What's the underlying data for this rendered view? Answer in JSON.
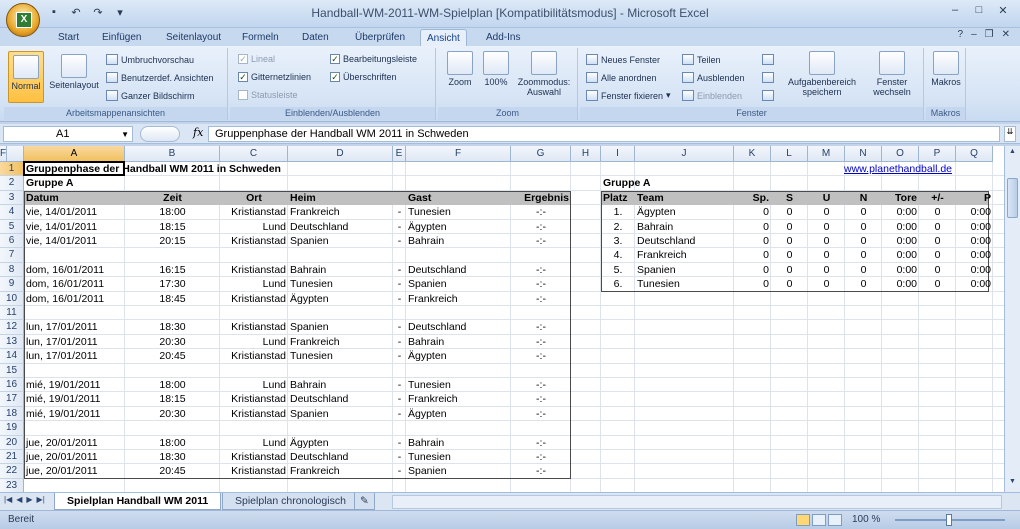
{
  "window": {
    "title": "Handball-WM-2011-WM-Spielplan  [Kompatibilitätsmodus] - Microsoft Excel"
  },
  "tabs": [
    "Start",
    "Einfügen",
    "Seitenlayout",
    "Formeln",
    "Daten",
    "Überprüfen",
    "Ansicht",
    "Add-Ins"
  ],
  "active_tab": "Ansicht",
  "ribbon": {
    "arbeitsmappen": {
      "label": "Arbeitsmappenansichten",
      "normal": "Normal",
      "seitenlayout": "Seitenlayout",
      "umbruch": "Umbruchvorschau",
      "benutzer": "Benutzerdef. Ansichten",
      "ganzer": "Ganzer Bildschirm"
    },
    "einblenden": {
      "label": "Einblenden/Ausblenden",
      "lineal": "Lineal",
      "gitternetz": "Gitternetzlinien",
      "statusleiste": "Statusleiste",
      "bearbeitung": "Bearbeitungsleiste",
      "ueberschriften": "Überschriften"
    },
    "zoom": {
      "label": "Zoom",
      "zoom": "Zoom",
      "hundert": "100%",
      "auswahl": "Zoommodus: Auswahl"
    },
    "fenster": {
      "label": "Fenster",
      "neues": "Neues Fenster",
      "alle": "Alle anordnen",
      "fixieren": "Fenster fixieren",
      "teilen": "Teilen",
      "ausblenden": "Ausblenden",
      "einblenden": "Einblenden",
      "aufgaben": "Aufgabenbereich speichern",
      "wechseln": "Fenster wechseln"
    },
    "makros": {
      "label": "Makros",
      "makros": "Makros"
    }
  },
  "formula_bar": {
    "name_box": "A1",
    "fx": "fx",
    "formula": "Gruppenphase der Handball WM 2011 in Schweden"
  },
  "columns": [
    "A",
    "B",
    "C",
    "D",
    "E",
    "F",
    "G",
    "H",
    "I",
    "J",
    "K",
    "L",
    "M",
    "N",
    "O",
    "P",
    "Q",
    "F"
  ],
  "rows": [
    "1",
    "2",
    "3",
    "4",
    "5",
    "6",
    "7",
    "8",
    "9",
    "10",
    "11",
    "12",
    "13",
    "14",
    "15",
    "16",
    "17",
    "18",
    "19",
    "20",
    "21",
    "22",
    "23"
  ],
  "sheet": {
    "title": "Gruppenphase der Handball WM 2011 in Schweden",
    "link": "www.planethandball.de",
    "group_label": "Gruppe A",
    "group_label_right": "Gruppe A",
    "headers": {
      "datum": "Datum",
      "zeit": "Zeit",
      "ort": "Ort",
      "heim": "Heim",
      "gast": "Gast",
      "ergebnis": "Ergebnis"
    },
    "matches": [
      {
        "row": 4,
        "datum": "vie, 14/01/2011",
        "zeit": "18:00",
        "ort": "Kristianstad",
        "heim": "Frankreich",
        "gast": "Tunesien",
        "erg": "-:-"
      },
      {
        "row": 5,
        "datum": "vie, 14/01/2011",
        "zeit": "18:15",
        "ort": "Lund",
        "heim": "Deutschland",
        "gast": "Ägypten",
        "erg": "-:-"
      },
      {
        "row": 6,
        "datum": "vie, 14/01/2011",
        "zeit": "20:15",
        "ort": "Kristianstad",
        "heim": "Spanien",
        "gast": "Bahrain",
        "erg": "-:-"
      },
      {
        "row": 8,
        "datum": "dom, 16/01/2011",
        "zeit": "16:15",
        "ort": "Kristianstad",
        "heim": "Bahrain",
        "gast": "Deutschland",
        "erg": "-:-"
      },
      {
        "row": 9,
        "datum": "dom, 16/01/2011",
        "zeit": "17:30",
        "ort": "Lund",
        "heim": "Tunesien",
        "gast": "Spanien",
        "erg": "-:-"
      },
      {
        "row": 10,
        "datum": "dom, 16/01/2011",
        "zeit": "18:45",
        "ort": "Kristianstad",
        "heim": "Ägypten",
        "gast": "Frankreich",
        "erg": "-:-"
      },
      {
        "row": 12,
        "datum": "lun, 17/01/2011",
        "zeit": "18:30",
        "ort": "Kristianstad",
        "heim": "Spanien",
        "gast": "Deutschland",
        "erg": "-:-"
      },
      {
        "row": 13,
        "datum": "lun, 17/01/2011",
        "zeit": "20:30",
        "ort": "Lund",
        "heim": "Frankreich",
        "gast": "Bahrain",
        "erg": "-:-"
      },
      {
        "row": 14,
        "datum": "lun, 17/01/2011",
        "zeit": "20:45",
        "ort": "Kristianstad",
        "heim": "Tunesien",
        "gast": "Ägypten",
        "erg": "-:-"
      },
      {
        "row": 16,
        "datum": "mié, 19/01/2011",
        "zeit": "18:00",
        "ort": "Lund",
        "heim": "Bahrain",
        "gast": "Tunesien",
        "erg": "-:-"
      },
      {
        "row": 17,
        "datum": "mié, 19/01/2011",
        "zeit": "18:15",
        "ort": "Kristianstad",
        "heim": "Deutschland",
        "gast": "Frankreich",
        "erg": "-:-"
      },
      {
        "row": 18,
        "datum": "mié, 19/01/2011",
        "zeit": "20:30",
        "ort": "Kristianstad",
        "heim": "Spanien",
        "gast": "Ägypten",
        "erg": "-:-"
      },
      {
        "row": 20,
        "datum": "jue, 20/01/2011",
        "zeit": "18:00",
        "ort": "Lund",
        "heim": "Ägypten",
        "gast": "Bahrain",
        "erg": "-:-"
      },
      {
        "row": 21,
        "datum": "jue, 20/01/2011",
        "zeit": "18:30",
        "ort": "Kristianstad",
        "heim": "Deutschland",
        "gast": "Tunesien",
        "erg": "-:-"
      },
      {
        "row": 22,
        "datum": "jue, 20/01/2011",
        "zeit": "20:45",
        "ort": "Kristianstad",
        "heim": "Frankreich",
        "gast": "Spanien",
        "erg": "-:-"
      }
    ],
    "dash": "-",
    "table_headers": [
      "Platz",
      "Team",
      "Sp.",
      "S",
      "U",
      "N",
      "Tore",
      "+/-",
      "P"
    ],
    "standings": [
      {
        "platz": "1.",
        "team": "Ägypten",
        "sp": "0",
        "s": "0",
        "u": "0",
        "n": "0",
        "tore": "0:00",
        "diff": "0",
        "p": "0:00"
      },
      {
        "platz": "2.",
        "team": "Bahrain",
        "sp": "0",
        "s": "0",
        "u": "0",
        "n": "0",
        "tore": "0:00",
        "diff": "0",
        "p": "0:00"
      },
      {
        "platz": "3.",
        "team": "Deutschland",
        "sp": "0",
        "s": "0",
        "u": "0",
        "n": "0",
        "tore": "0:00",
        "diff": "0",
        "p": "0:00"
      },
      {
        "platz": "4.",
        "team": "Frankreich",
        "sp": "0",
        "s": "0",
        "u": "0",
        "n": "0",
        "tore": "0:00",
        "diff": "0",
        "p": "0:00"
      },
      {
        "platz": "5.",
        "team": "Spanien",
        "sp": "0",
        "s": "0",
        "u": "0",
        "n": "0",
        "tore": "0:00",
        "diff": "0",
        "p": "0:00"
      },
      {
        "platz": "6.",
        "team": "Tunesien",
        "sp": "0",
        "s": "0",
        "u": "0",
        "n": "0",
        "tore": "0:00",
        "diff": "0",
        "p": "0:00"
      }
    ]
  },
  "sheet_tabs": [
    "Spielplan Handball WM 2011",
    "Spielplan chronologisch"
  ],
  "status": {
    "text": "Bereit",
    "zoom": "100 %"
  }
}
